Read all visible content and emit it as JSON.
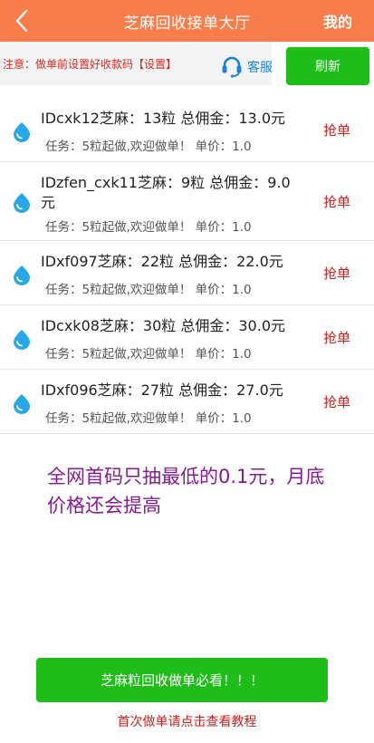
{
  "colors": {
    "header_bg": "#f87d4b",
    "accent_green": "#1fbd1a",
    "notice_red": "#e0281f",
    "grab_red": "#c3241f",
    "promo_purple": "#861a93",
    "service_blue": "#1c83d6"
  },
  "header": {
    "back_icon": "chevron-left-icon",
    "title": "芝麻回收接单大厅",
    "mine_label": "我的"
  },
  "notice": {
    "text": "注意：做单前设置好收款码【设置】",
    "service_icon": "headset-icon",
    "service_label": "客服",
    "refresh_label": "刷新"
  },
  "orders": [
    {
      "title": "IDcxk12芝麻：13粒 总佣金：13.0元",
      "subtitle": "任务：5粒起做,欢迎做单！ 单价：1.0",
      "action": "抢单"
    },
    {
      "title": "IDzfen_cxk11芝麻：9粒 总佣金：9.0元",
      "subtitle": "任务：5粒起做,欢迎做单！ 单价：1.0",
      "action": "抢单"
    },
    {
      "title": "IDxf097芝麻：22粒 总佣金：22.0元",
      "subtitle": "任务：5粒起做,欢迎做单！ 单价：1.0",
      "action": "抢单"
    },
    {
      "title": "IDcxk08芝麻：30粒 总佣金：30.0元",
      "subtitle": "任务：5粒起做,欢迎做单！ 单价：1.0",
      "action": "抢单"
    },
    {
      "title": "IDxf096芝麻：27粒 总佣金：27.0元",
      "subtitle": "任务：5粒起做,欢迎做单！ 单价：1.0",
      "action": "抢单"
    }
  ],
  "promo": {
    "text": "全网首码只抽最低的0.1元，月底价格还会提高"
  },
  "footer": {
    "cta_label": "芝麻粒回收做单必看！！！",
    "tutorial_link": "首次做单请点击查看教程"
  }
}
